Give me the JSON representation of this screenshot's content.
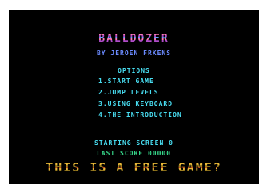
{
  "game": {
    "title": "BALLDOZER",
    "author": "BY JEROEN FRKENS",
    "options_heading": "OPTIONS",
    "menu": [
      {
        "label": "1.START GAME"
      },
      {
        "label": "2.JUMP LEVELS"
      },
      {
        "label": "3.USING KEYBOARD"
      },
      {
        "label": "4.THE INTRODUCTION"
      }
    ],
    "starting_screen": "STARTING SCREEN 0",
    "last_score": "LAST SCORE 00000",
    "banner": "THIS IS A FREE GAME?"
  },
  "colors": {
    "background": "#000000",
    "menu_text": "#48dcf0",
    "author_text": "#6b8bff",
    "score_text": "#36d88a"
  }
}
